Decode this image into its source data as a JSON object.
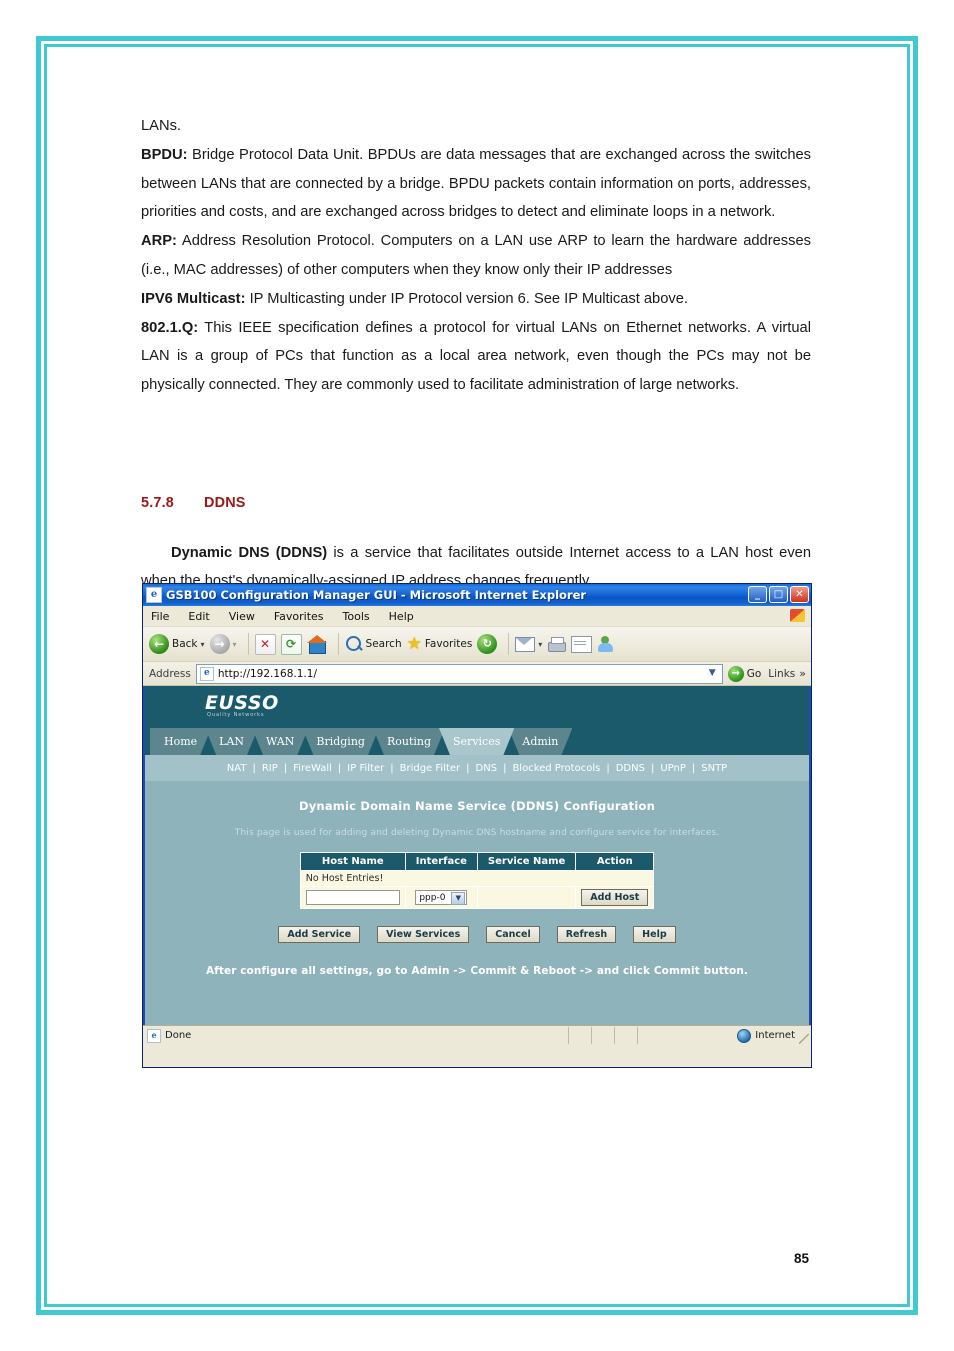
{
  "document": {
    "paragraphs": [
      {
        "lead": "",
        "text": "LANs."
      },
      {
        "lead": "BPDU:",
        "text": " Bridge Protocol Data Unit. BPDUs are data messages that are exchanged across the switches between LANs that are connected by a bridge. BPDU packets contain information on ports, addresses, priorities and costs, and are exchanged across bridges to detect and eliminate loops in a network."
      },
      {
        "lead": "ARP:",
        "text": " Address Resolution Protocol. Computers on a LAN use ARP to learn the hardware addresses (i.e., MAC addresses) of other computers when they know only their IP addresses"
      },
      {
        "lead": "IPV6 Multicast:",
        "text": " IP Multicasting under IP Protocol version 6. See IP Multicast above."
      },
      {
        "lead": "802.1.Q:",
        "text": " This IEEE specification defines a protocol for virtual LANs on Ethernet networks. A virtual LAN is a group of PCs that function as a local area network, even though the PCs may not be physically connected. They are commonly used to facilitate administration of large networks."
      }
    ],
    "section": {
      "number": "5.7.8",
      "title": "DDNS"
    },
    "ddns_intro_bold": "Dynamic DNS (DDNS)",
    "ddns_intro_rest": " is a service that facilitates outside Internet access to a LAN host even when the host's dynamically-assigned IP address changes frequently.",
    "page_number": "85",
    "frame_color": "#3fc9d1",
    "heading_color": "#9e1616"
  },
  "browser": {
    "title": "GSB100 Configuration Manager GUI - Microsoft Internet Explorer",
    "window_buttons": {
      "minimize": "_",
      "maximize": "□",
      "close": "✕"
    },
    "menu": [
      "File",
      "Edit",
      "View",
      "Favorites",
      "Tools",
      "Help"
    ],
    "toolbar": {
      "back": "Back",
      "forward": "",
      "stop": "✕",
      "refresh": "⟳",
      "home": "",
      "search": "Search",
      "favorites": "Favorites",
      "history": "",
      "mail": "",
      "print": "",
      "edit": "",
      "messenger": ""
    },
    "address": {
      "label": "Address",
      "url": "http://192.168.1.1/",
      "go": "Go",
      "links": "Links",
      "chevron": "»",
      "caret": "▼"
    },
    "status": {
      "text": "Done",
      "zone": "Internet"
    }
  },
  "router": {
    "brand": "EUSSO",
    "brand_sub": "Quality Networks",
    "tabs": [
      {
        "label": "Home",
        "active": false
      },
      {
        "label": "LAN",
        "active": false
      },
      {
        "label": "WAN",
        "active": false
      },
      {
        "label": "Bridging",
        "active": false
      },
      {
        "label": "Routing",
        "active": false
      },
      {
        "label": "Services",
        "active": true
      },
      {
        "label": "Admin",
        "active": false
      }
    ],
    "subnav": [
      "NAT",
      "RIP",
      "FireWall",
      "IP Filter",
      "Bridge Filter",
      "DNS",
      "Blocked Protocols",
      "DDNS",
      "UPnP",
      "SNTP"
    ],
    "page_title": "Dynamic Domain Name Service (DDNS) Configuration",
    "page_desc": "This page is used for adding and deleting Dynamic DNS hostname and configure service for interfaces.",
    "table": {
      "headers": [
        "Host Name",
        "Interface",
        "Service Name",
        "Action"
      ],
      "empty_message": "No Host Entries!",
      "input_row": {
        "host_name_value": "",
        "interface_value": "ppp-0",
        "service_name_value": "",
        "action_button": "Add Host"
      }
    },
    "buttons": [
      "Add Service",
      "View Services",
      "Cancel",
      "Refresh",
      "Help"
    ],
    "footer_note": "After configure all settings, go to Admin -> Commit & Reboot -> and click Commit button.",
    "colors": {
      "header_dark_teal": "#1b5a6b",
      "body_teal": "#8fb3bb",
      "subnav_teal": "#a2c1c8",
      "tab_inactive": "#5d858e",
      "tab_active": "#a8c6cc",
      "table_cell": "#fbf8e2"
    }
  }
}
